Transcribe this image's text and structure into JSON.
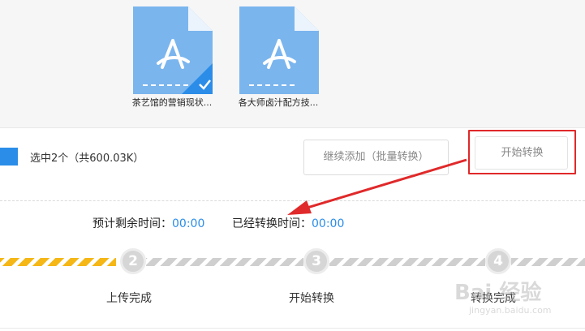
{
  "files": [
    {
      "name": "茶艺馆的营销现状...",
      "icon": "pdf-file-icon",
      "selected": true
    },
    {
      "name": "各大师卤汁配方技...",
      "icon": "pdf-file-icon",
      "selected": false
    }
  ],
  "selection": {
    "info": "选中2个（共600.03K）"
  },
  "buttons": {
    "add_more": "继续添加（批量转换）",
    "start": "开始转换"
  },
  "timing": {
    "remaining_label": "预计剩余时间：",
    "remaining_value": "00:00",
    "elapsed_label": "已经转换时间：",
    "elapsed_value": "00:00"
  },
  "steps": [
    {
      "number": "2",
      "label": "上传完成"
    },
    {
      "number": "3",
      "label": "开始转换"
    },
    {
      "number": "4",
      "label": "转换完成"
    }
  ],
  "watermark": {
    "main": "Bai 经验",
    "sub": "jingyan.baidu.com"
  },
  "colors": {
    "accent": "#2b8de8",
    "file_icon": "#7ab5ee",
    "highlight": "#e0292a",
    "progress_done": "#f5b716"
  }
}
